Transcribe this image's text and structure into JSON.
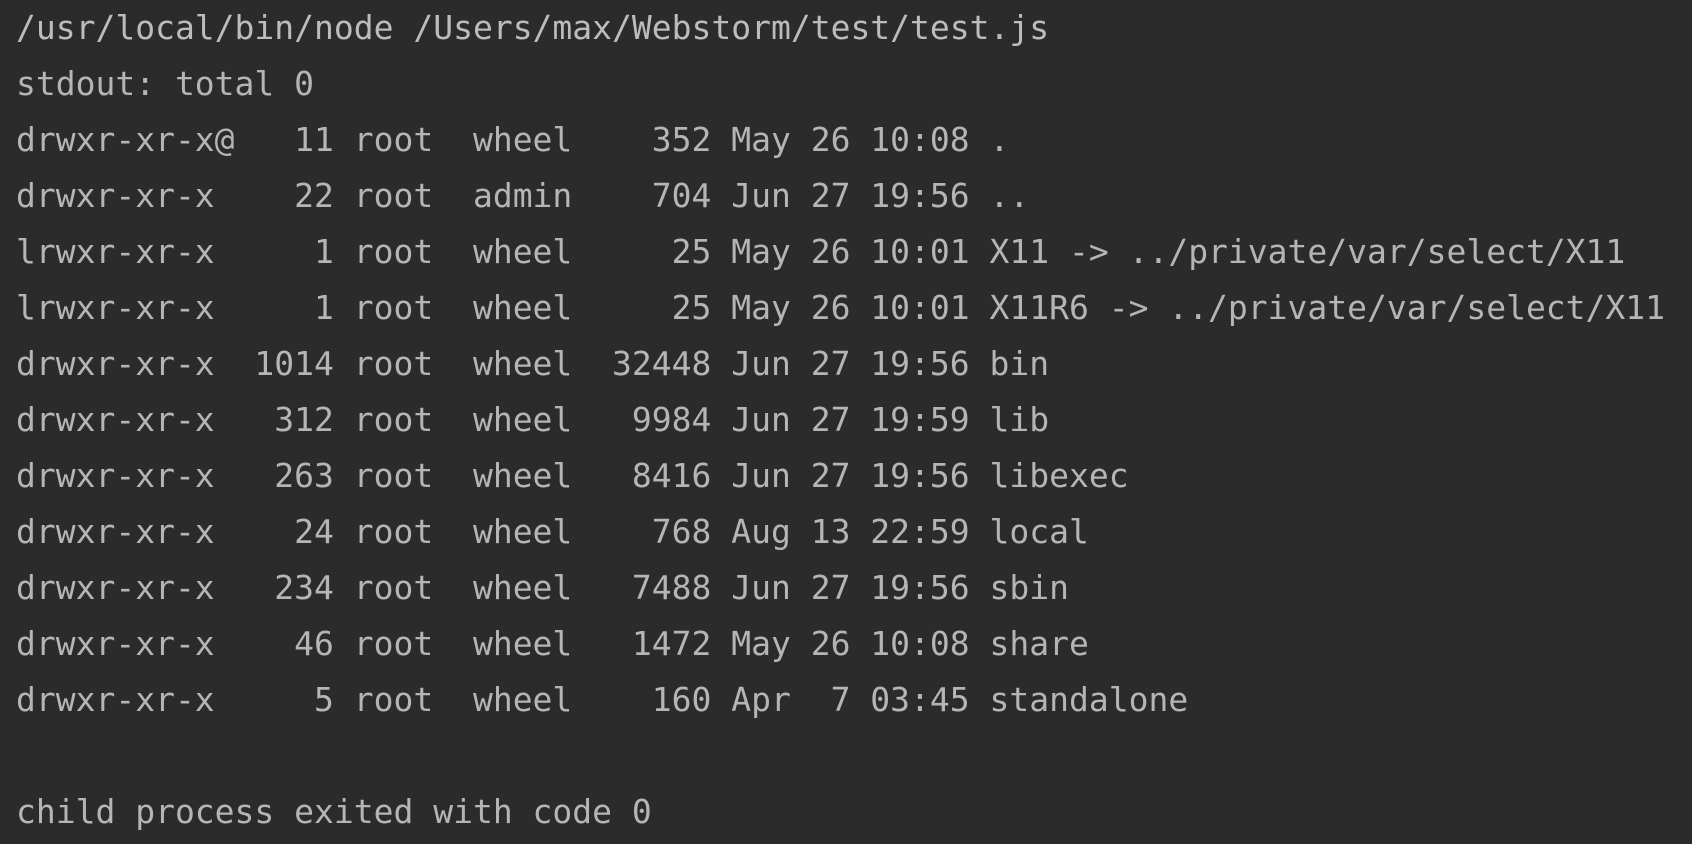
{
  "theme": {
    "background": "#2b2b2b",
    "foreground": "#b5b5b5"
  },
  "console": {
    "command": "/usr/local/bin/node /Users/max/Webstorm/test/test.js",
    "stdout_header": "stdout: total 0",
    "rows": [
      "drwxr-xr-x@   11 root  wheel    352 May 26 10:08 .",
      "drwxr-xr-x    22 root  admin    704 Jun 27 19:56 ..",
      "lrwxr-xr-x     1 root  wheel     25 May 26 10:01 X11 -> ../private/var/select/X11",
      "lrwxr-xr-x     1 root  wheel     25 May 26 10:01 X11R6 -> ../private/var/select/X11",
      "drwxr-xr-x  1014 root  wheel  32448 Jun 27 19:56 bin",
      "drwxr-xr-x   312 root  wheel   9984 Jun 27 19:59 lib",
      "drwxr-xr-x   263 root  wheel   8416 Jun 27 19:56 libexec",
      "drwxr-xr-x    24 root  wheel    768 Aug 13 22:59 local",
      "drwxr-xr-x   234 root  wheel   7488 Jun 27 19:56 sbin",
      "drwxr-xr-x    46 root  wheel   1472 May 26 10:08 share",
      "drwxr-xr-x     5 root  wheel    160 Apr  7 03:45 standalone"
    ],
    "exit_message": "child process exited with code 0"
  }
}
